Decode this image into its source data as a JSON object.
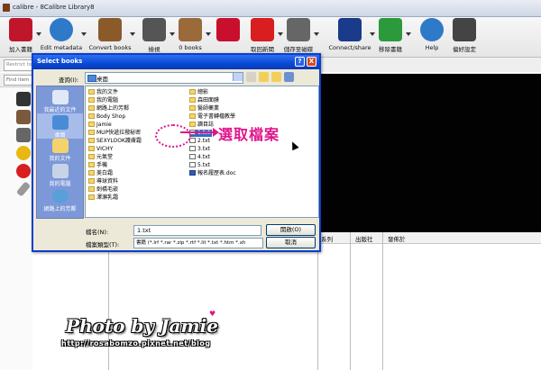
{
  "window": {
    "title": "calibre - 8Calibre Library8"
  },
  "toolbar": {
    "items": [
      {
        "label": "加入書籍",
        "icon": "add-book-icon",
        "color": "#c0162b"
      },
      {
        "label": "Edit metadata",
        "icon": "info-icon",
        "color": "#2f79c9"
      },
      {
        "label": "Convert books",
        "icon": "convert-books-icon",
        "color": "#8a5a2b"
      },
      {
        "label": "檢視",
        "icon": "magnifier-icon",
        "color": "#555555"
      },
      {
        "label": "0 books",
        "icon": "books-icon",
        "color": "#9a6a3a"
      },
      {
        "label": "",
        "icon": "heart-icon",
        "color": "#c8102e"
      },
      {
        "label": "取回新聞",
        "icon": "news-icon",
        "color": "#d81e1e"
      },
      {
        "label": "儲存至磁碟",
        "icon": "save-disk-icon",
        "color": "#666666"
      },
      {
        "label": "Connect/share",
        "icon": "connect-share-icon",
        "color": "#1a3a8a"
      },
      {
        "label": "移除書籍",
        "icon": "recycle-icon",
        "color": "#2c9a3c"
      },
      {
        "label": "Help",
        "icon": "help-icon",
        "color": "#2f79c9"
      },
      {
        "label": "偏好設定",
        "icon": "gear-icon",
        "color": "#444444"
      }
    ]
  },
  "search": {
    "restrict_placeholder": "Restrict to",
    "find_placeholder": "Find item"
  },
  "columns": [
    "系列",
    "出版社",
    "發佈於"
  ],
  "dialog": {
    "title": "Select books",
    "help": "?",
    "close": "X",
    "lookin_label": "查詢(I):",
    "lookin_value": "桌面",
    "places": [
      {
        "label": "我最近的文件",
        "icon": "recent-docs-icon"
      },
      {
        "label": "桌面",
        "icon": "desktop-icon"
      },
      {
        "label": "我的文件",
        "icon": "my-documents-icon"
      },
      {
        "label": "我的電腦",
        "icon": "my-computer-icon"
      },
      {
        "label": "網路上的芳鄰",
        "icon": "network-places-icon"
      }
    ],
    "files_col1": [
      {
        "name": "我的文件",
        "type": "folder"
      },
      {
        "name": "我的電腦",
        "type": "folder"
      },
      {
        "name": "網路上的芳鄰",
        "type": "folder"
      },
      {
        "name": "Body Shop",
        "type": "folder"
      },
      {
        "name": "Jamie",
        "type": "folder"
      },
      {
        "name": "MUP快遞拉撥秘密",
        "type": "folder"
      },
      {
        "name": "SEXYLOOK護膚霜",
        "type": "folder"
      },
      {
        "name": "VICHY",
        "type": "folder"
      },
      {
        "name": "元氣堂",
        "type": "folder"
      },
      {
        "name": "手機",
        "type": "folder"
      },
      {
        "name": "美白霜",
        "type": "folder"
      },
      {
        "name": "導球資料",
        "type": "folder"
      },
      {
        "name": "劍橋毛嵌",
        "type": "folder"
      },
      {
        "name": "澤瀨乳霜",
        "type": "folder"
      }
    ],
    "files_col2": [
      {
        "name": "總影",
        "type": "folder"
      },
      {
        "name": "森田面膜",
        "type": "folder"
      },
      {
        "name": "醫師藥業",
        "type": "folder"
      },
      {
        "name": "電子書轉檔教學",
        "type": "folder"
      },
      {
        "name": "讀目誌",
        "type": "folder"
      },
      {
        "name": "1.txt",
        "type": "txt",
        "selected": true
      },
      {
        "name": "2.txt",
        "type": "txt"
      },
      {
        "name": "3.txt",
        "type": "txt"
      },
      {
        "name": "4.txt",
        "type": "txt"
      },
      {
        "name": "5.txt",
        "type": "txt"
      },
      {
        "name": "報名履歷表.doc",
        "type": "doc"
      }
    ],
    "filename_label": "檔名(N):",
    "filename_value": "1.txt",
    "filetype_label": "檔案類型(T):",
    "filetype_value": "書籍 (*.lrf *.rar *.zip *.rtf *.lit *.txt *.htm *.xh",
    "open_button": "開啟(O)",
    "cancel_button": "取消"
  },
  "annotation": {
    "text": "選取檔案",
    "color": "#e0158b"
  },
  "watermark": {
    "line1": "Photo by Jamie",
    "line2": "http://rosabomzo.pixnet.net/blog"
  }
}
